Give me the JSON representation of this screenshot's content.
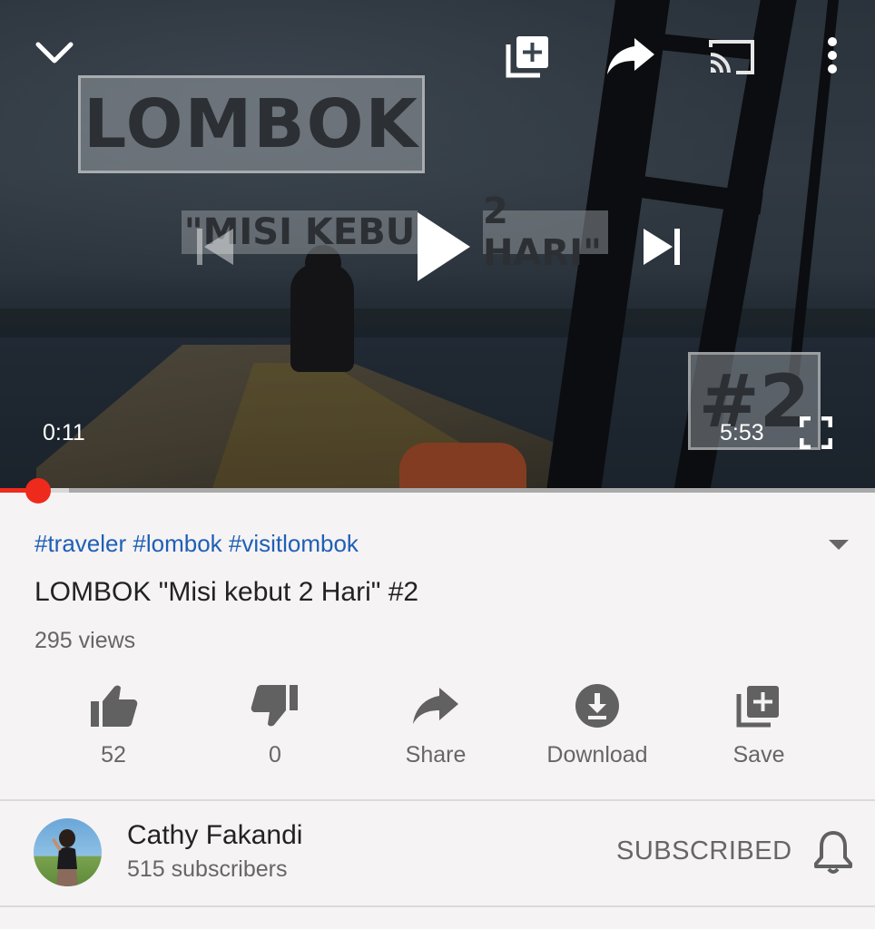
{
  "player": {
    "overlay_title": "LOMBOK",
    "overlay_subtitle_left": "\"MISI KEBU",
    "overlay_subtitle_right": "2 HARI\"",
    "overlay_tag": "#2",
    "current_time": "0:11",
    "duration": "5:53",
    "progress_fraction": 0.031,
    "icons": {
      "collapse": "chevron-down-icon",
      "add_to_playlist": "playlist-add-icon",
      "share": "share-icon",
      "cast": "cast-icon",
      "more": "more-vert-icon",
      "previous": "skip-previous-icon",
      "play": "play-icon",
      "next": "skip-next-icon",
      "fullscreen": "fullscreen-icon"
    }
  },
  "video": {
    "hashtags": "#traveler #lombok #visitlombok",
    "title": "LOMBOK \"Misi kebut 2 Hari\" #2",
    "views": "295 views"
  },
  "actions": [
    {
      "label": "52",
      "icon": "thumb-up-icon"
    },
    {
      "label": "0",
      "icon": "thumb-down-icon"
    },
    {
      "label": "Share",
      "icon": "share-icon"
    },
    {
      "label": "Download",
      "icon": "download-icon"
    },
    {
      "label": "Save",
      "icon": "playlist-add-icon"
    }
  ],
  "channel": {
    "name": "Cathy Fakandi",
    "subscribers": "515 subscribers",
    "subscribe_state": "SUBSCRIBED"
  },
  "colors": {
    "accent_red": "#ee2a1c",
    "link_blue": "#1f5fb6",
    "icon_gray": "#616161",
    "background": "#f5f3f4"
  }
}
